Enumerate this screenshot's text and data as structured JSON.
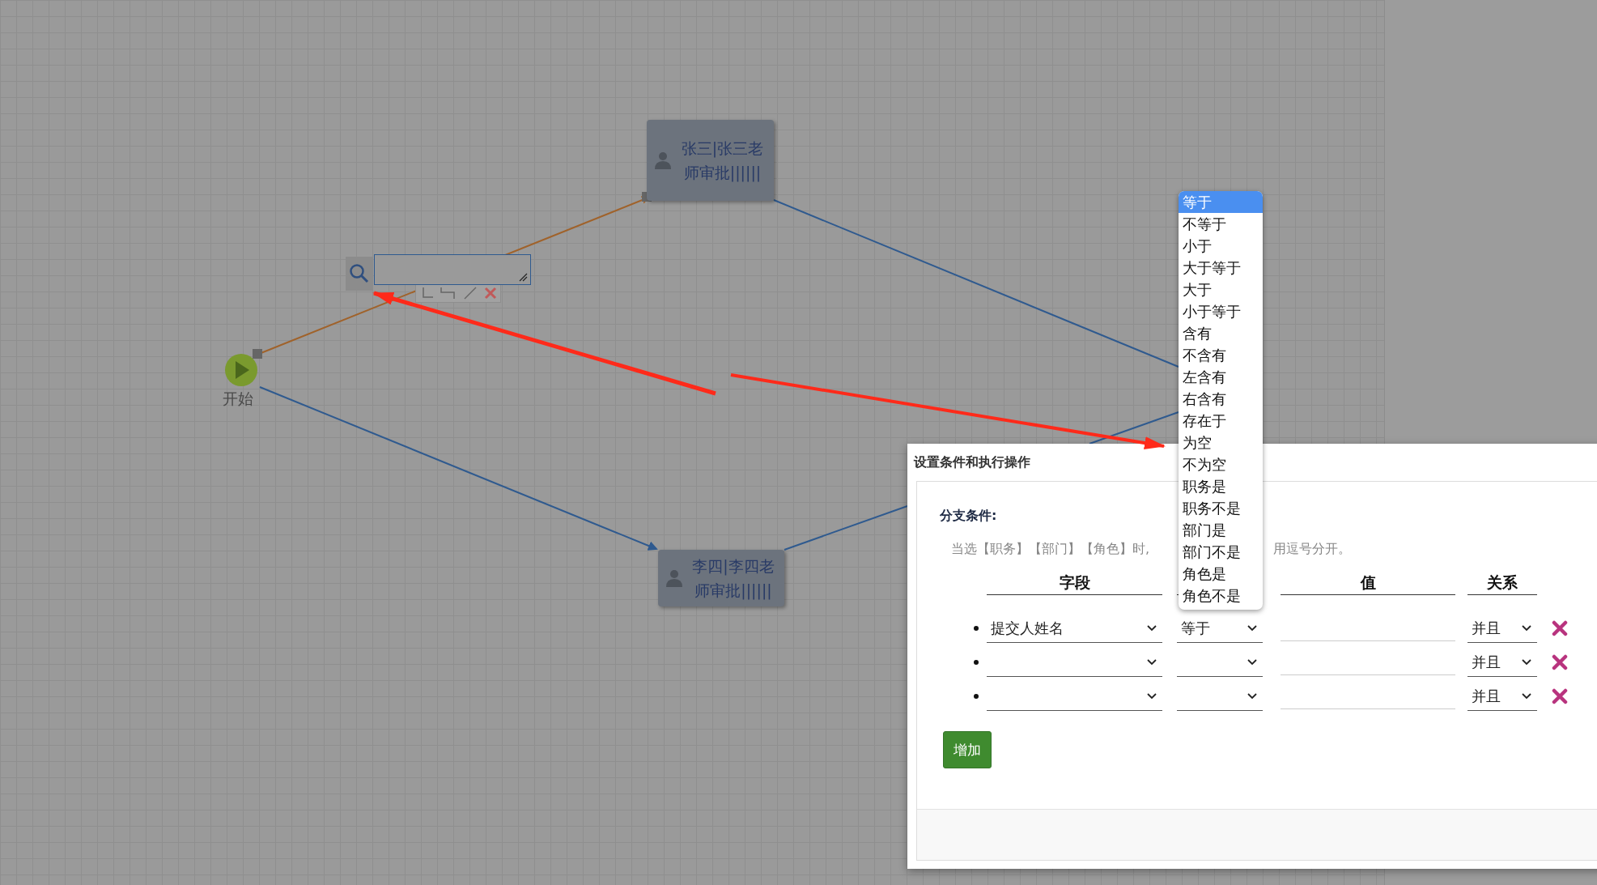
{
  "canvas": {
    "nodes": [
      {
        "kind": "start",
        "label": "开始"
      },
      {
        "kind": "task",
        "label": "张三|张三老师审批||||||"
      },
      {
        "kind": "task",
        "label": "李四|李四老师审批||||||"
      }
    ]
  },
  "dialog": {
    "title": "设置条件和执行操作",
    "section_label": "分支条件:",
    "hint_parts": [
      "当选【职务】【部门】【角色】时,",
      "用逗号分开。"
    ],
    "columns": {
      "field": "字段",
      "value": "值",
      "relation": "关系"
    },
    "rows": [
      {
        "field": "提交人姓名",
        "operator": "等于",
        "relation": "并且"
      },
      {
        "relation": "并且"
      },
      {
        "relation": "并且"
      }
    ],
    "add_button": "增加"
  },
  "operator_dropdown": {
    "options": [
      {
        "label": "等于",
        "selected": true
      },
      {
        "label": "不等于",
        "selected": false
      },
      {
        "label": "小于",
        "selected": false
      },
      {
        "label": "大于等于",
        "selected": false
      },
      {
        "label": "大于",
        "selected": false
      },
      {
        "label": "小于等于",
        "selected": false
      },
      {
        "label": "含有",
        "selected": false
      },
      {
        "label": "不含有",
        "selected": false
      },
      {
        "label": "左含有",
        "selected": false
      },
      {
        "label": "右含有",
        "selected": false
      },
      {
        "label": "存在于",
        "selected": false
      },
      {
        "label": "为空",
        "selected": false
      },
      {
        "label": "不为空",
        "selected": false
      },
      {
        "label": "职务是",
        "selected": false
      },
      {
        "label": "职务不是",
        "selected": false
      },
      {
        "label": "部门是",
        "selected": false
      },
      {
        "label": "部门不是",
        "selected": false
      },
      {
        "label": "角色是",
        "selected": false
      },
      {
        "label": "角色不是",
        "selected": false
      }
    ]
  }
}
